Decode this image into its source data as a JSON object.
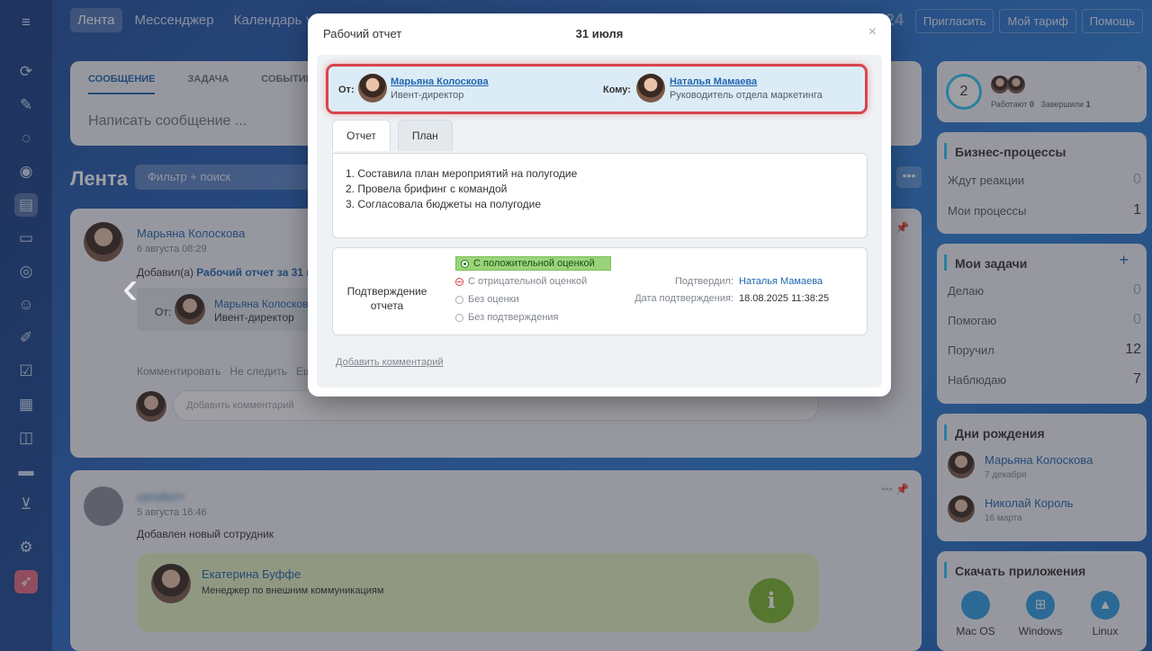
{
  "topbar": {
    "nav": [
      "Лента",
      "Мессенджер",
      "Календарь ˅"
    ],
    "logo_fragment": "24",
    "right_buttons": [
      "Пригласить",
      "Мой тариф",
      "Помощь"
    ]
  },
  "composer": {
    "tabs": [
      "СООБЩЕНИЕ",
      "ЗАДАЧА",
      "СОБЫТИЕ"
    ],
    "placeholder": "Написать сообщение ..."
  },
  "feed": {
    "title": "Лента",
    "filter_placeholder": "Фильтр + поиск",
    "post1": {
      "author": "Марьяна Колоскова",
      "time": "6 августа 08:29",
      "added_prefix": "Добавил(а)",
      "added_link": "Рабочий отчет за 31 ию",
      "from_label": "От:",
      "from_name": "Марьяна Колосков",
      "from_role": "Ивент-директор",
      "actions": [
        "Комментировать",
        "Не следить",
        "Ещё"
      ],
      "comment_placeholder": "Добавить комментарий"
    },
    "post2": {
      "author": "сатоботт",
      "time": "5 августа 16:46",
      "text": "Добавлен новый сотрудник",
      "employee_name": "Екатерина Буффе",
      "employee_role": "Менеджер по внешним коммуникациям"
    }
  },
  "right": {
    "workload": {
      "count": "2",
      "working_label": "Работают",
      "working": "0",
      "done_label": "Завершили",
      "done": "1"
    },
    "business": {
      "title": "Бизнес-процессы",
      "rows": [
        {
          "label": "Ждут реакции",
          "count": "0"
        },
        {
          "label": "Мои процессы",
          "count": "1"
        }
      ]
    },
    "tasks": {
      "title": "Мои задачи",
      "add": "+",
      "rows": [
        {
          "label": "Делаю",
          "count": "0"
        },
        {
          "label": "Помогаю",
          "count": "0"
        },
        {
          "label": "Поручил",
          "count": "12"
        },
        {
          "label": "Наблюдаю",
          "count": "7"
        }
      ]
    },
    "birthdays": {
      "title": "Дни рождения",
      "people": [
        {
          "name": "Марьяна Колоскова",
          "date": "7 декабря"
        },
        {
          "name": "Николай Король",
          "date": "16 марта"
        }
      ]
    },
    "apps": {
      "title": "Скачать приложения",
      "items": [
        "Mac OS",
        "Windows",
        "Linux"
      ]
    }
  },
  "modal": {
    "title": "Рабочий отчет",
    "date": "31 июля",
    "close": "×",
    "from_label": "От:",
    "from_name": "Марьяна Колоскова",
    "from_role": "Ивент-директор",
    "to_label": "Кому:",
    "to_name": "Наталья Мамаева",
    "to_role": "Руководитель отдела маркетинга",
    "tabs": [
      "Отчет",
      "План"
    ],
    "report_lines": [
      "1. Составила план мероприятий на полугодие",
      "2. Провела брифинг с командой",
      "3. Согласовала бюджеты на полугодие"
    ],
    "confirm_label": "Подтверждение отчета",
    "options": [
      "С положительной оценкой",
      "С отрицательной оценкой",
      "Без оценки",
      "Без подтверждения"
    ],
    "confirmed_by_label": "Подтвердил:",
    "confirmed_by": "Наталья Мамаева",
    "confirm_date_label": "Дата подтверждения:",
    "confirm_date": "18.08.2025 11:38:25",
    "add_comment": "Добавить комментарий"
  }
}
